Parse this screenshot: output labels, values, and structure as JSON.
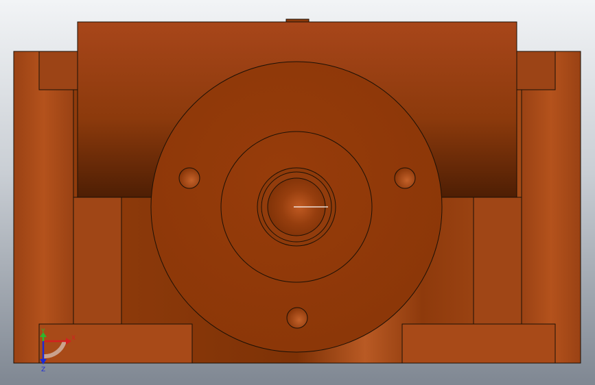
{
  "colors": {
    "background_top": "#e4e8ec",
    "background_bottom": "#8a929c",
    "part_base": "#a34a16",
    "part_dark": "#7a3208",
    "part_light": "#c4642a",
    "edge": "#1a1006",
    "axis_x": "#d42020",
    "axis_y": "#2cb82c",
    "axis_z": "#1c2ad8"
  },
  "triad": {
    "x_label": "X",
    "y_label": "Y",
    "z_label": "Z"
  }
}
